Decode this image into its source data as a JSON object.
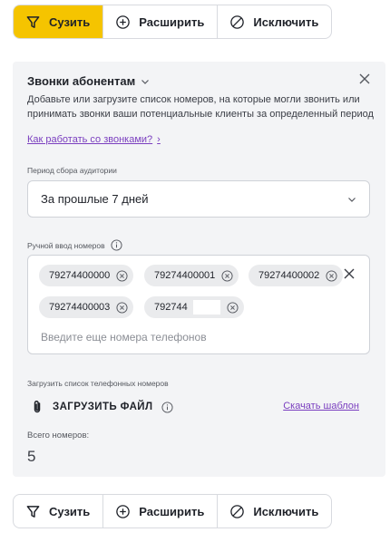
{
  "top_toolbar": {
    "narrow_label": "Сузить",
    "expand_label": "Расширить",
    "exclude_label": "Исключить",
    "active": "narrow",
    "active_color": "#f5c400"
  },
  "panel": {
    "title": "Звонки абонентам",
    "description": "Добавьте или загрузите список номеров, на которые могли звонить или принимать звонки ваши потенциальные клиенты за определенный период",
    "help_link": "Как работать со звонками?",
    "help_chevron": "›",
    "period": {
      "label": "Период сбора аудитории",
      "value": "За прошлые 7 дней"
    },
    "manual": {
      "label": "Ручной ввод номеров",
      "chips": [
        "79274400000",
        "79274400001",
        "79274400002",
        "79274400003",
        "792744"
      ],
      "placeholder": "Введите еще номера телефонов"
    },
    "upload": {
      "label": "Загрузить список телефонных номеров",
      "button": "ЗАГРУЗИТЬ ФАЙЛ",
      "template_link": "Скачать шаблон"
    },
    "total": {
      "label": "Всего номеров:",
      "value": "5"
    },
    "link_color": "#7a3ebf",
    "background": "#f3f4f6"
  },
  "bottom_toolbar": {
    "narrow_label": "Сузить",
    "expand_label": "Расширить",
    "exclude_label": "Исключить"
  }
}
